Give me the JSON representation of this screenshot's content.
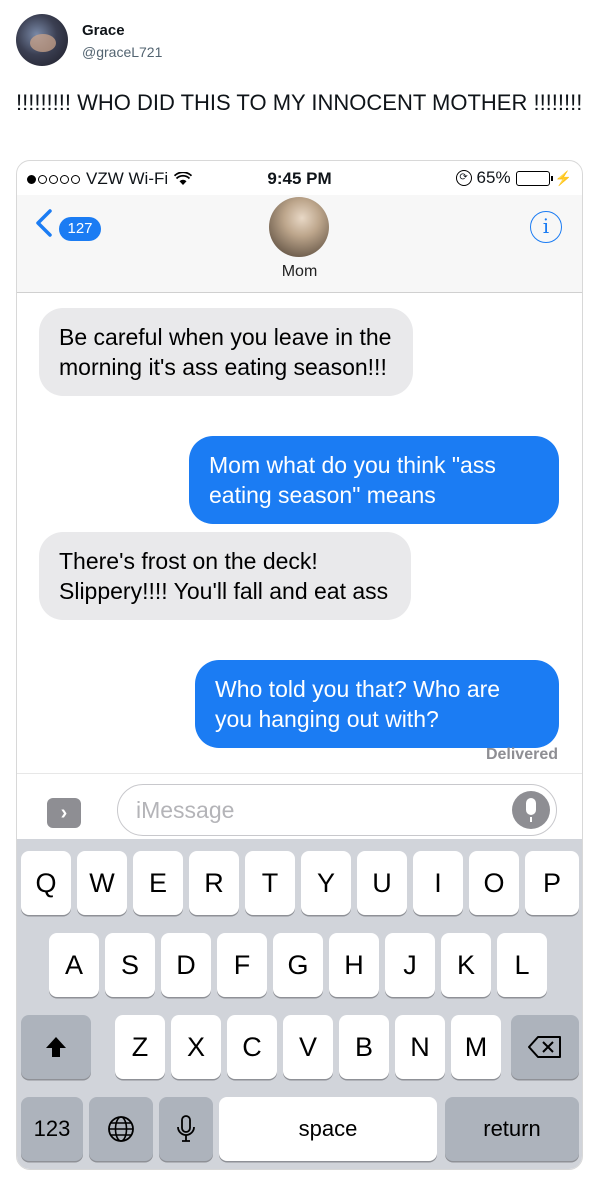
{
  "tweet": {
    "display_name": "Grace",
    "handle": "@graceL721",
    "text": "!!!!!!!!! WHO DID THIS TO MY INNOCENT MOTHER !!!!!!!!"
  },
  "phone": {
    "status": {
      "carrier": "VZW Wi-Fi",
      "time": "9:45 PM",
      "battery": "65%",
      "battery_level": 0.65,
      "signal_bars": 1,
      "battery_color": "#2bc83f"
    },
    "header": {
      "back_count": "127",
      "contact_name": "Mom",
      "info_symbol": "i"
    },
    "messages": [
      {
        "direction": "incoming",
        "text": "Be careful when you leave in the morning it's ass eating season!!!"
      },
      {
        "direction": "outgoing",
        "text": "Mom what do you think \"ass eating season\" means"
      },
      {
        "direction": "incoming",
        "text": "There's frost on the deck! Slippery!!!! You'll fall and eat ass"
      },
      {
        "direction": "outgoing",
        "text": "Who told you that? Who are you hanging out with?"
      }
    ],
    "delivered_label": "Delivered",
    "input": {
      "placeholder": "iMessage"
    },
    "keyboard": {
      "row1": [
        "Q",
        "W",
        "E",
        "R",
        "T",
        "Y",
        "U",
        "I",
        "O",
        "P"
      ],
      "row2": [
        "A",
        "S",
        "D",
        "F",
        "G",
        "H",
        "J",
        "K",
        "L"
      ],
      "row3": [
        "Z",
        "X",
        "C",
        "V",
        "B",
        "N",
        "M"
      ],
      "numbers_key": "123",
      "space_key": "space",
      "return_key": "return"
    },
    "colors": {
      "blue": "#1b7cf3",
      "incoming_bubble": "#e9e9eb",
      "keyboard_bg": "#d1d4da"
    }
  }
}
